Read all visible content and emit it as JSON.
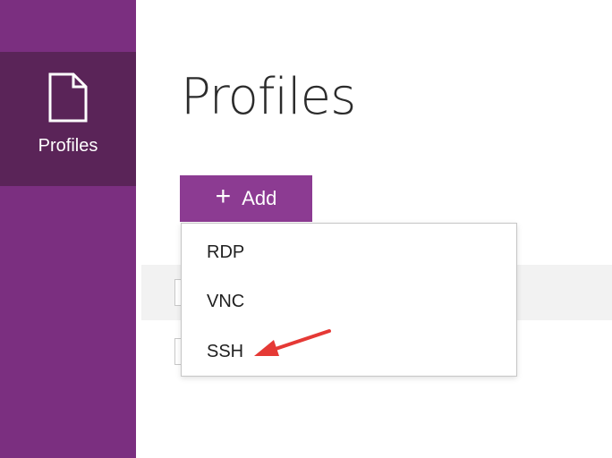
{
  "sidebar": {
    "items": [
      {
        "label": "Profiles",
        "icon": "document-icon",
        "selected": true
      }
    ]
  },
  "main": {
    "title": "Profiles",
    "add_button": {
      "label": "Add",
      "icon": "plus-icon"
    }
  },
  "add_menu": {
    "items": [
      {
        "label": "RDP"
      },
      {
        "label": "VNC"
      },
      {
        "label": "SSH"
      }
    ]
  },
  "annotation": {
    "icon": "red-arrow-icon",
    "color": "#e53935",
    "points_to": "SSH"
  },
  "colors": {
    "sidebar": "#7b2f80",
    "sidebar_selected": "#5a2458",
    "accent": "#8c3b92"
  }
}
